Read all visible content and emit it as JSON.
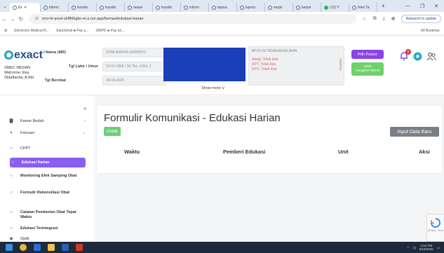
{
  "browser": {
    "tabs": [
      {
        "label": "Ek",
        "active": true
      },
      {
        "label": "inform",
        "active": false
      },
      {
        "label": "transfe",
        "active": false
      },
      {
        "label": "transfe",
        "active": false
      },
      {
        "label": "rawat-",
        "active": false
      },
      {
        "label": "transfe",
        "active": false
      },
      {
        "label": "inform",
        "active": false
      },
      {
        "label": "lapora",
        "active": false
      },
      {
        "label": "lapora",
        "active": false
      },
      {
        "label": "empir",
        "active": false
      },
      {
        "label": "lampir",
        "active": false
      },
      {
        "label": "(13) Y",
        "active": false
      },
      {
        "label": "New Ta",
        "active": false
      }
    ],
    "url": "emr-fe-prod-uhf865gko-et.a.run.app/farmasi/edukasi-harian",
    "update_label": "Relaunch to update",
    "bookmarks": [
      "Electronic Medical R...",
      "SatuSehat ♣ Pay a...",
      "SNIPD ♣ Pay an..."
    ],
    "all_bookmarks": "All Bookmar"
  },
  "header": {
    "brand": "exact",
    "hospital_name": "SMEC MEDAN",
    "welcome": "Welcome, Eka Oktaflanita, A.Md",
    "patient": {
      "name_label": "Nama (MR)",
      "name_value": "DONI ANDIKA (00003972",
      "dob_label": "Tgl Lahir / Umur",
      "dob_value": "19-01-1995 / 30 Thn, 4 Bln, 1",
      "visit_label": "Tgl Berobat",
      "visit_value": "28-04-2025"
    },
    "bpjs": {
      "title": "BPJS KETENAGAKERJAAN",
      "lines": [
        "Alergi: Tidak Ada",
        "RPT: Tidak Ada",
        "RPO: Tidak Ada"
      ]
    },
    "pilih_pasien": "Pilih Pasien",
    "ubah_alergi": [
      "Ubah",
      "Alergi/RPT/RPO"
    ],
    "notif_count": "9",
    "show_more": "Show more ∨"
  },
  "sidebar": {
    "collapse": "«",
    "items": [
      {
        "label": "Kamar Bedah",
        "icon": "bed-icon",
        "chevron": "›"
      },
      {
        "label": "Farmasi",
        "icon": "pill-icon",
        "chevron": "⌄"
      },
      {
        "label": "CPPT",
        "icon": "circle-icon"
      },
      {
        "label": "Edukasi Harian",
        "icon": "circle-icon"
      },
      {
        "label": "Monitoring Efek Samping Obat",
        "icon": "circle-icon"
      },
      {
        "label": "Formulir Rekonsiliasi Obat",
        "icon": "circle-icon"
      },
      {
        "label": "Catatan Pemberian Obat Tepat Waktu",
        "icon": "circle-icon"
      },
      {
        "label": "Edukasi Terintegrasi",
        "icon": "circle-icon"
      },
      {
        "label": "Optik",
        "icon": "eye-icon"
      }
    ]
  },
  "main": {
    "title": "Formulir Komunikasi - Edukasi Harian",
    "cetak": "Cetak",
    "input_baru": "Input Data Baru",
    "columns": [
      "Waktu",
      "Pemberi Edukasi",
      "Unit",
      "Aksi"
    ]
  },
  "recaptcha": "Privacy - Term",
  "taskbar": {
    "time": "2:02 PM",
    "date": "5/19/2025"
  },
  "colors": {
    "accent": "#8a5ef0",
    "green": "#6ccf7b",
    "redaction": "#1b3fb8"
  }
}
